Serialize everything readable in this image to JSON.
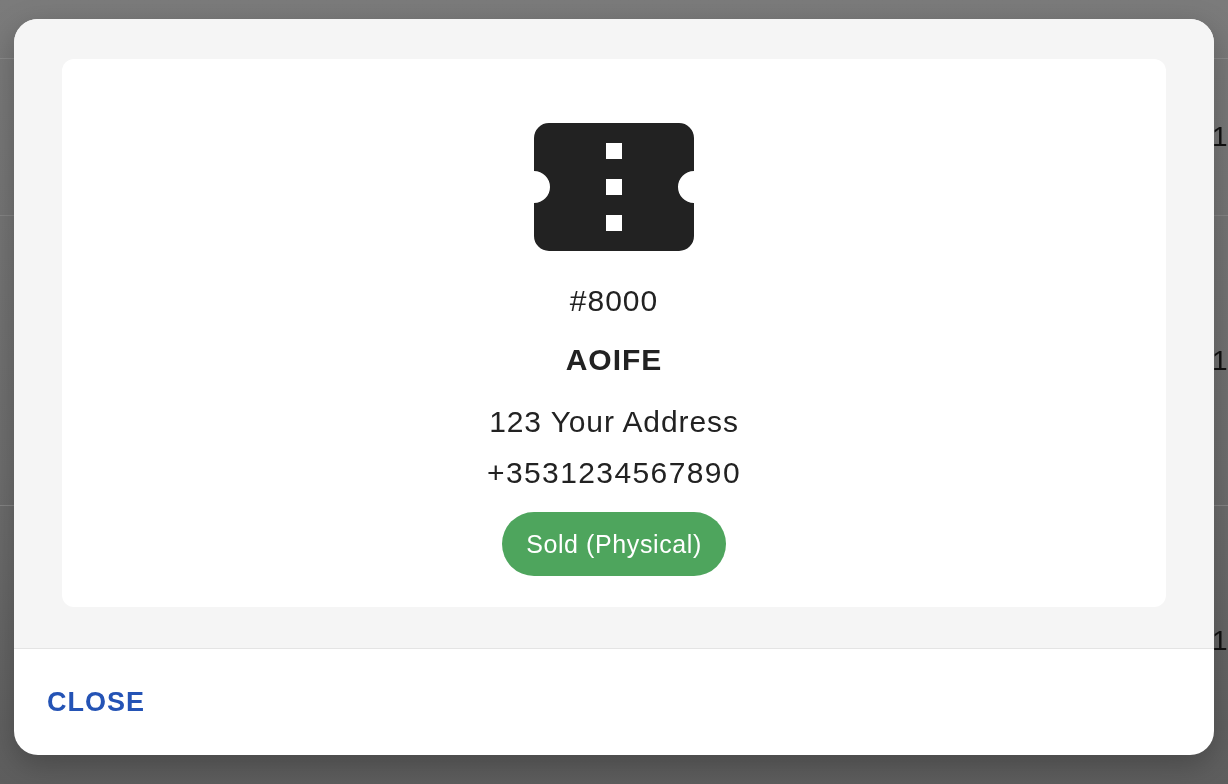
{
  "background_table": {
    "rows": [
      {
        "cells": [
          "1"
        ]
      },
      {
        "cells": [
          "1"
        ]
      },
      {
        "cells": [
          "1"
        ]
      }
    ]
  },
  "dialog": {
    "ticket": {
      "number": "#8000",
      "name": "AOIFE",
      "address": "123 Your Address",
      "phone": "+3531234567890",
      "status": "Sold (Physical)"
    },
    "actions": [
      {
        "label": "CLOSE"
      }
    ]
  }
}
